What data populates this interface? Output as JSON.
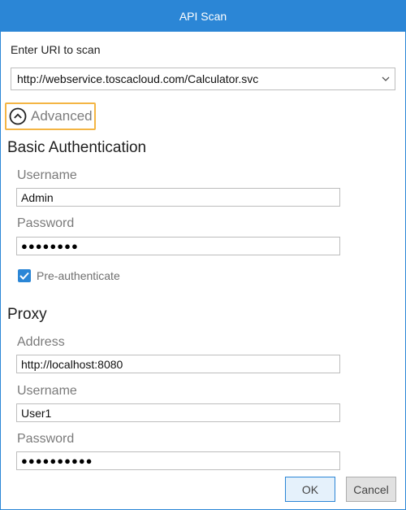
{
  "window": {
    "title": "API Scan"
  },
  "uri": {
    "label": "Enter URI to scan",
    "value": "http://webservice.toscacloud.com/Calculator.svc",
    "chevron_icon": "chevron-down-icon"
  },
  "advanced": {
    "label": "Advanced",
    "icon": "chevron-up-circle-icon"
  },
  "basic_auth": {
    "title": "Basic Authentication",
    "username_label": "Username",
    "username_value": "Admin",
    "password_label": "Password",
    "password_value": "●●●●●●●●",
    "preauth_label": "Pre-authenticate",
    "preauth_checked": true
  },
  "proxy": {
    "title": "Proxy",
    "address_label": "Address",
    "address_value": "http://localhost:8080",
    "username_label": "Username",
    "username_value": "User1",
    "password_label": "Password",
    "password_value": "●●●●●●●●●●"
  },
  "buttons": {
    "ok": "OK",
    "cancel": "Cancel"
  },
  "colors": {
    "accent": "#2b86d6",
    "highlight": "#f4b544"
  }
}
